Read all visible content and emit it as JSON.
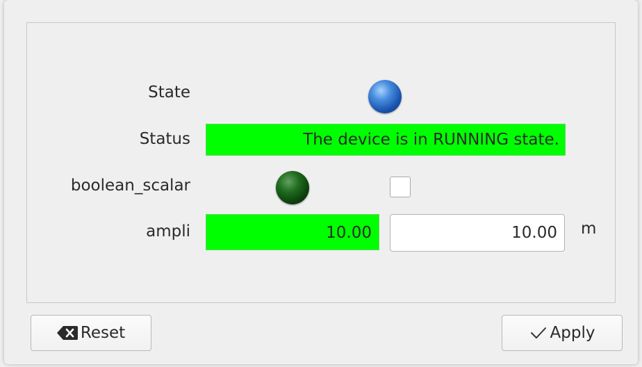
{
  "form": {
    "state_label": "State",
    "status_label": "Status",
    "status_value": "The device is in RUNNING state.",
    "boolean_label": "boolean_scalar",
    "boolean_checked": false,
    "ampli_label": "ampli",
    "ampli_read_value": "10.00",
    "ampli_write_value": "10.00",
    "ampli_unit": "m"
  },
  "indicators": {
    "state_led_color": "#2a6fd0",
    "boolean_led_color": "#0d4a0d",
    "ok_background": "#00ff00"
  },
  "buttons": {
    "reset_label": "Reset",
    "apply_label": "Apply"
  },
  "icons": {
    "reset": "backspace-icon",
    "apply": "checkmark-icon"
  }
}
